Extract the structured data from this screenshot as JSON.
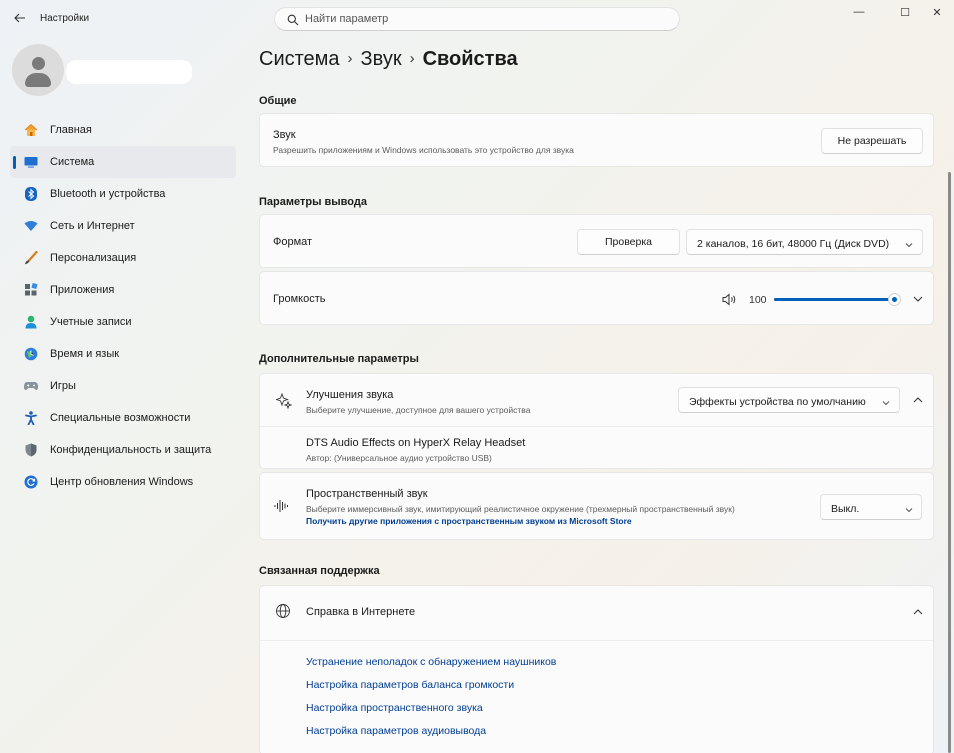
{
  "app": {
    "title": "Настройки",
    "back_icon": "arrow-left-icon"
  },
  "search": {
    "placeholder": "Найти параметр"
  },
  "window_controls": {
    "minimize": "—",
    "maximize": "☐",
    "close": "✕"
  },
  "sidebar": {
    "items": [
      {
        "label": "Главная",
        "icon": "home-icon",
        "active": false
      },
      {
        "label": "Система",
        "icon": "system-icon",
        "active": true
      },
      {
        "label": "Bluetooth и устройства",
        "icon": "bluetooth-icon",
        "active": false
      },
      {
        "label": "Сеть и Интернет",
        "icon": "wifi-icon",
        "active": false
      },
      {
        "label": "Персонализация",
        "icon": "brush-icon",
        "active": false
      },
      {
        "label": "Приложения",
        "icon": "apps-icon",
        "active": false
      },
      {
        "label": "Учетные записи",
        "icon": "account-icon",
        "active": false
      },
      {
        "label": "Время и язык",
        "icon": "time-language-icon",
        "active": false
      },
      {
        "label": "Игры",
        "icon": "gamepad-icon",
        "active": false
      },
      {
        "label": "Специальные возможности",
        "icon": "accessibility-icon",
        "active": false
      },
      {
        "label": "Конфиденциальность и защита",
        "icon": "shield-icon",
        "active": false
      },
      {
        "label": "Центр обновления Windows",
        "icon": "windows-update-icon",
        "active": false
      }
    ]
  },
  "breadcrumb": {
    "part1": "Система",
    "part2": "Звук",
    "current": "Свойства",
    "separator": "›"
  },
  "general": {
    "section_title": "Общие",
    "sound": {
      "title": "Звук",
      "description": "Разрешить приложениям и Windows использовать это устройство для звука",
      "button": "Не разрешать"
    }
  },
  "output": {
    "section_title": "Параметры вывода",
    "format": {
      "title": "Формат",
      "test_button": "Проверка",
      "value": "2 каналов, 16 бит, 48000 Гц (Диск DVD)"
    },
    "volume": {
      "title": "Громкость",
      "value": "100",
      "level": 1.0,
      "icon": "speaker-icon"
    }
  },
  "advanced": {
    "section_title": "Дополнительные параметры",
    "enhancements": {
      "title": "Улучшения звука",
      "description": "Выберите улучшение, доступное для вашего устройства",
      "value": "Эффекты устройства по умолчанию",
      "effect_name": "DTS Audio Effects on HyperX Relay Headset",
      "effect_author": "Автор: (Универсальное аудио устройство USB)"
    },
    "spatial": {
      "title": "Пространственный звук",
      "description": "Выберите иммерсивный звук, имитирующий реалистичное окружение (трехмерный пространственный звук)",
      "store_link": "Получить другие приложения с пространственным звуком из Microsoft Store",
      "value": "Выкл."
    }
  },
  "support": {
    "section_title": "Связанная поддержка",
    "web_help": {
      "title": "Справка в Интернете",
      "links": [
        "Устранение неполадок с обнаружением наушников",
        "Настройка параметров баланса громкости",
        "Настройка пространственного звука",
        "Настройка параметров аудиовывода"
      ]
    }
  },
  "colors": {
    "accent": "#005fb8",
    "link": "#003e92"
  }
}
